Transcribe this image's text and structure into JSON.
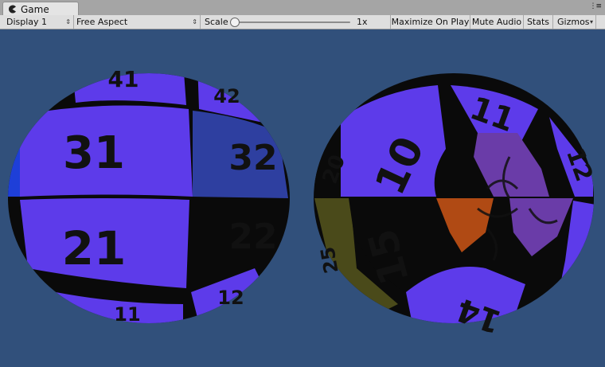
{
  "tab": {
    "title": "Game",
    "icon": "pacman-icon"
  },
  "window_menu": "⋮≡",
  "toolbar": {
    "display": "Display 1",
    "aspect": "Free Aspect",
    "scale_label": "Scale",
    "scale_value": "1x",
    "scale_fraction": 0.0,
    "maximize": "Maximize On Play",
    "mute": "Mute Audio",
    "stats": "Stats",
    "gizmos": "Gizmos"
  },
  "colors": {
    "viewport_bg": "#31507b",
    "sphere_purple": "#5d3bea",
    "sphere_black": "#0a0a0a"
  },
  "left_sphere": {
    "numbers": [
      "31",
      "32",
      "21",
      "22",
      "41",
      "42",
      "11",
      "12"
    ]
  },
  "right_sphere": {
    "numbers": [
      "10",
      "11",
      "12",
      "15",
      "14",
      "20",
      "25"
    ]
  }
}
